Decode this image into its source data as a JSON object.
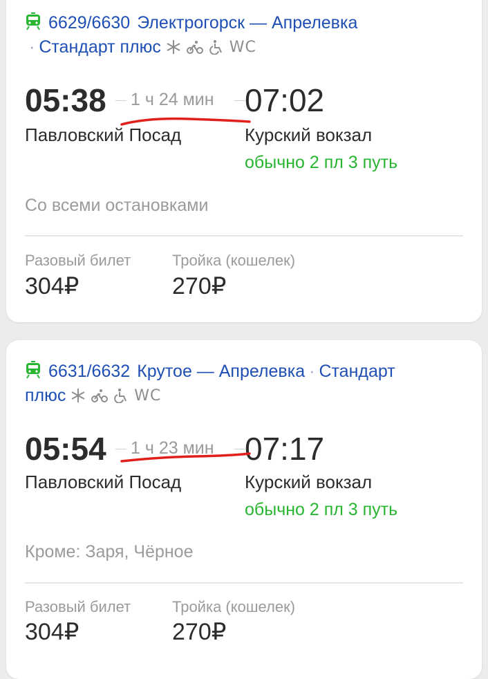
{
  "trains": [
    {
      "number": "6629/6630",
      "route": "Электрогорск — Апрелевка",
      "category": "Стандарт плюс",
      "amenities": [
        "snowflake-icon",
        "bicycle-icon",
        "wheelchair-icon",
        "WC"
      ],
      "departure_time": "05:38",
      "duration": "1 ч 24 мин",
      "arrival_time": "07:02",
      "departure_station": "Павловский Посад",
      "arrival_station": "Курский вокзал",
      "platform_info": "обычно 2 пл 3 путь",
      "stops": "Со всеми остановками",
      "price_single_label": "Разовый билет",
      "price_single": "304₽",
      "price_troika_label": "Тройка (кошелек)",
      "price_troika": "270₽"
    },
    {
      "number": "6631/6632",
      "route": "Крутое — Апрелевка",
      "category": "Стандарт",
      "category_cont": "плюс",
      "amenities": [
        "snowflake-icon",
        "bicycle-icon",
        "wheelchair-icon",
        "WC"
      ],
      "departure_time": "05:54",
      "duration": "1 ч 23 мин",
      "arrival_time": "07:17",
      "departure_station": "Павловский Посад",
      "arrival_station": "Курский вокзал",
      "platform_info": "обычно 2 пл 3 путь",
      "stops": "Кроме: Заря, Чёрное",
      "price_single_label": "Разовый билет",
      "price_single": "304₽",
      "price_troika_label": "Тройка (кошелек)",
      "price_troika": "270₽"
    }
  ],
  "colors": {
    "link": "#1e4fb5",
    "train_icon": "#27b532",
    "platform": "#27b532",
    "annotation": "#e0201b"
  }
}
